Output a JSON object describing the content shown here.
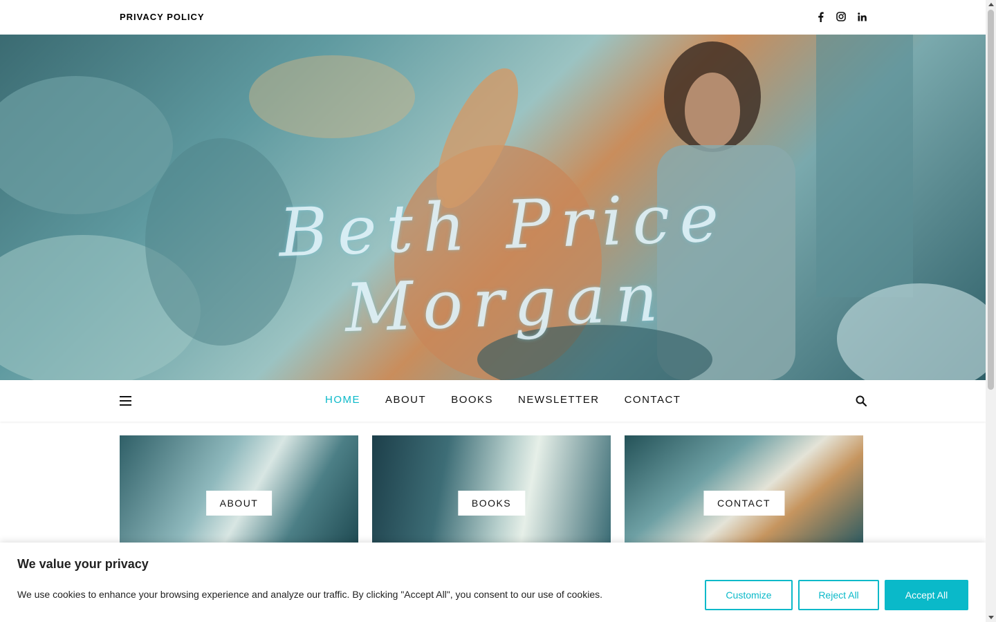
{
  "topbar": {
    "privacy_label": "PRIVACY POLICY",
    "socials": [
      "facebook-icon",
      "instagram-icon",
      "linkedin-icon"
    ]
  },
  "hero": {
    "site_title": "Beth Price Morgan"
  },
  "nav": {
    "items": [
      {
        "label": "HOME",
        "active": true
      },
      {
        "label": "ABOUT",
        "active": false
      },
      {
        "label": "BOOKS",
        "active": false
      },
      {
        "label": "NEWSLETTER",
        "active": false
      },
      {
        "label": "CONTACT",
        "active": false
      }
    ]
  },
  "features": [
    {
      "label": "ABOUT"
    },
    {
      "label": "BOOKS"
    },
    {
      "label": "CONTACT"
    }
  ],
  "cookie": {
    "title": "We value your privacy",
    "message": "We use cookies to enhance your browsing experience and analyze our traffic. By clicking \"Accept All\", you consent to our use of cookies.",
    "customize_label": "Customize",
    "reject_label": "Reject All",
    "accept_label": "Accept All"
  },
  "colors": {
    "accent": "#0ab9c9"
  }
}
